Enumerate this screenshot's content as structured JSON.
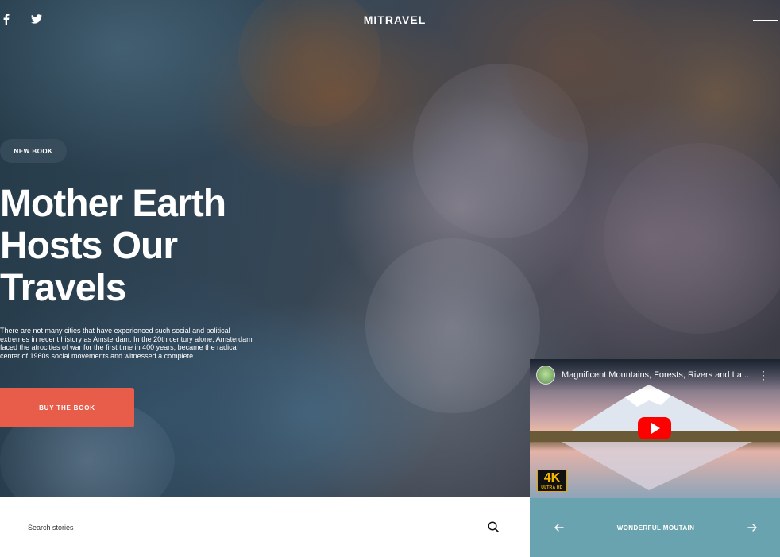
{
  "header": {
    "brand": "MITRAVEL",
    "social": [
      "facebook-icon",
      "twitter-icon"
    ],
    "menu_icon": "hamburger-icon"
  },
  "hero": {
    "badge": "NEW BOOK",
    "headline": "Mother Earth Hosts Our Travels",
    "blurb": "There are not many cities that have experienced such social and political extremes in recent history as Amsterdam. In the 20th century alone, Amsterdam faced the atrocities of war for the first time in 400 years, became the radical center of 1960s social movements and witnessed a complete",
    "cta_label": "BUY THE BOOK",
    "cta_color": "#e85c4a"
  },
  "search": {
    "placeholder": "Search stories",
    "icon": "search-icon"
  },
  "video": {
    "title": "Magnificent Mountains, Forests, Rivers and La...",
    "badge_main": "4K",
    "badge_sub": "ULTRA HD",
    "play_color": "#ff0000"
  },
  "slider": {
    "label": "WONDERFUL MOUTAIN",
    "background": "#6aa3b0"
  }
}
